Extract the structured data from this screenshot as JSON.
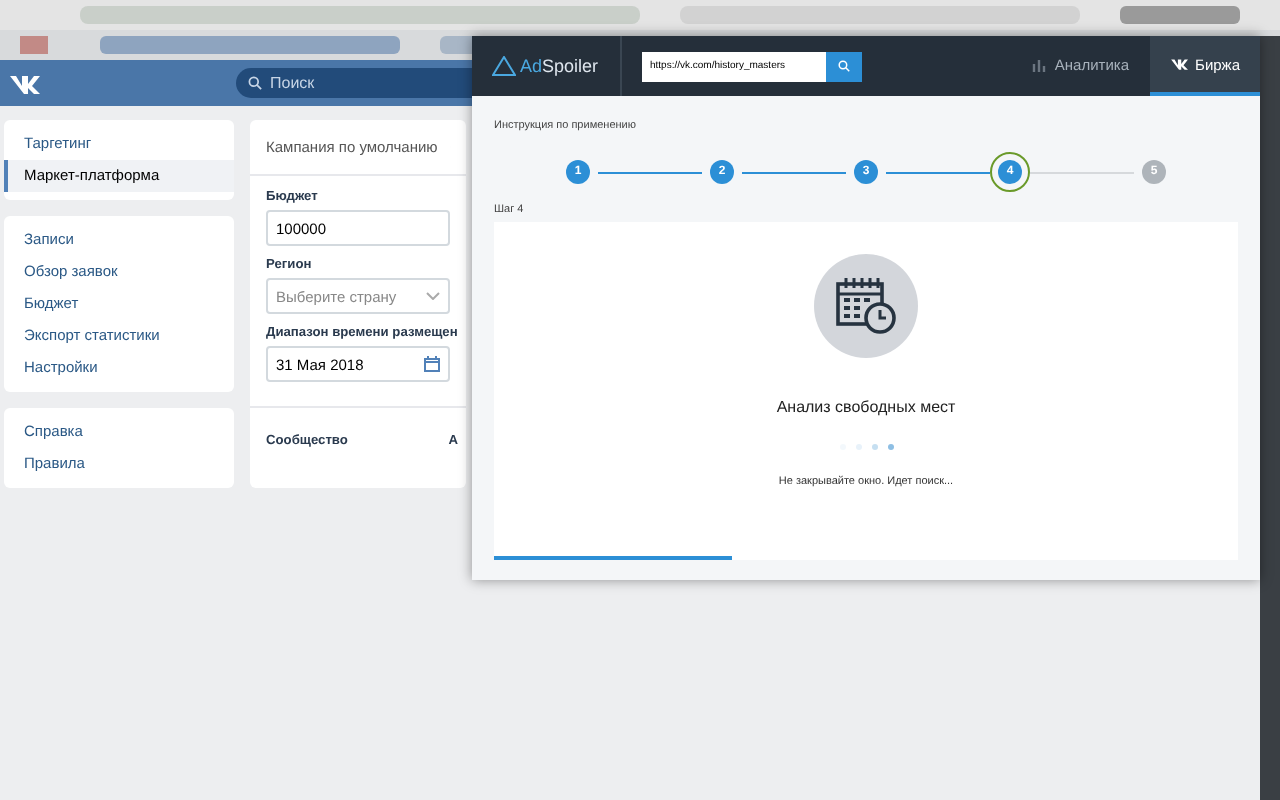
{
  "vk_header": {
    "search": {
      "placeholder": "Поиск"
    }
  },
  "sidebar": {
    "groups": [
      {
        "items": [
          {
            "label": "Таргетинг",
            "selected": false
          },
          {
            "label": "Маркет-платформа",
            "selected": true
          }
        ]
      },
      {
        "items": [
          {
            "label": "Записи",
            "selected": false
          },
          {
            "label": "Обзор заявок",
            "selected": false
          },
          {
            "label": "Бюджет",
            "selected": false
          },
          {
            "label": "Экспорт статистики",
            "selected": false
          },
          {
            "label": "Настройки",
            "selected": false
          }
        ]
      },
      {
        "items": [
          {
            "label": "Справка",
            "selected": false
          },
          {
            "label": "Правила",
            "selected": false
          }
        ]
      }
    ]
  },
  "campaign": {
    "title": "Кампания по умолчанию",
    "fields": [
      {
        "kind": "text",
        "label": "Бюджет",
        "value": "100000"
      },
      {
        "kind": "select",
        "label": "Регион",
        "placeholder": "Выберите страну"
      },
      {
        "kind": "date",
        "label": "Диапазон времени размещен",
        "value": "31 Мая 2018"
      }
    ],
    "community": {
      "label": "Сообщество",
      "value": "А"
    }
  },
  "popup": {
    "logo": {
      "part1": "Ad",
      "part2": "Spoiler"
    },
    "url": {
      "value": "https://vk.com/history_masters"
    },
    "tabs": [
      {
        "label": "Аналитика",
        "selected": false
      },
      {
        "label": "Биржа",
        "selected": true
      }
    ],
    "instruction": "Инструкция по применению",
    "steps": [
      {
        "label": "1",
        "done": true,
        "selected": false
      },
      {
        "label": "2",
        "done": true,
        "selected": false
      },
      {
        "label": "3",
        "done": true,
        "selected": false
      },
      {
        "label": "4",
        "done": true,
        "selected": true
      },
      {
        "label": "5",
        "done": false,
        "selected": false
      }
    ],
    "step_title": "Шаг 4",
    "status_title": "Анализ свободных мест",
    "status_text": "Не закрывайте окно. Идет поиск...",
    "progress": {
      "level": 0.32
    }
  }
}
